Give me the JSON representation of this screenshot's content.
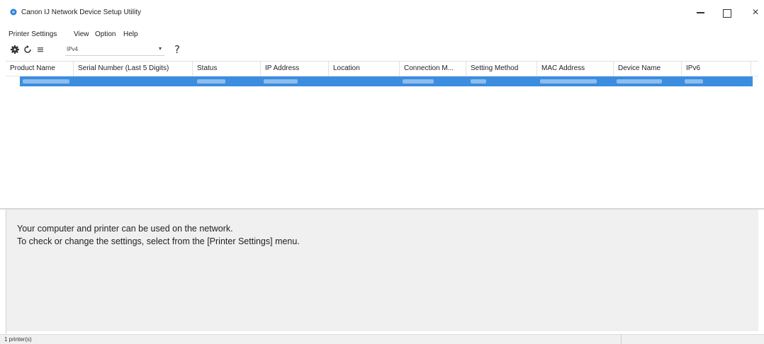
{
  "window": {
    "title": "Canon IJ Network Device Setup Utility",
    "controls": {
      "minimize": "minimize",
      "maximize": "maximize",
      "close": "×"
    }
  },
  "menu": {
    "items": [
      "Printer Settings",
      "View",
      "Option",
      "Help"
    ]
  },
  "toolbar": {
    "icons": [
      "settings-gear-icon",
      "refresh-icon",
      "list-view-icon"
    ],
    "protocol_select": {
      "value": "IPv4",
      "arrow": "▾"
    },
    "help_label": "?"
  },
  "table": {
    "columns": [
      "Product Name",
      "Serial Number (Last 5 Digits)",
      "Status",
      "IP Address",
      "Location",
      "Connection M...",
      "Setting Method",
      "MAC Address",
      "Device Name",
      "IPv6"
    ],
    "selected_row_obscured": true,
    "accent_color": "#3b8de0"
  },
  "message": {
    "line1": "Your computer and printer can be used on the network.",
    "line2": "To check or change the settings, select from the [Printer Settings] menu."
  },
  "status": {
    "text": "1 printer(s)"
  }
}
